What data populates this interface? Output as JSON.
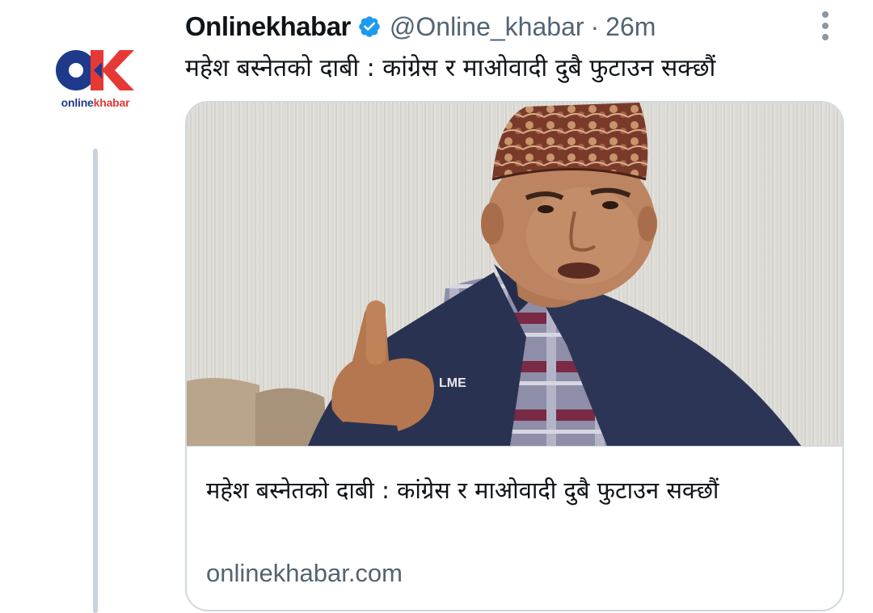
{
  "avatar": {
    "brand_online": "online",
    "brand_khabar": "khabar",
    "colors": {
      "blue": "#1f3a8a",
      "red": "#e53935"
    }
  },
  "header": {
    "display_name": "Onlinekhabar",
    "handle": "@Online_khabar",
    "separator": "·",
    "time": "26m",
    "verified_icon": "verified-badge-icon",
    "more_icon": "more-vertical-icon"
  },
  "tweet": {
    "text": "महेश बस्नेतको दाबी : कांग्रेस र माओवादी दुबै फुटाउन सक्छौं"
  },
  "card": {
    "title": "महेश बस्नेतको दाबी : कांग्रेस र माओवादी दुबै फुटाउन सक्छौं",
    "domain": "onlinekhabar.com",
    "image_subject": "man-wearing-dhaka-topi-pointing-finger",
    "jacket_logo": "LME"
  },
  "colors": {
    "text_primary": "#0f1419",
    "text_secondary": "#536471",
    "verified": "#1d9bf0",
    "border": "#cfd9de"
  }
}
